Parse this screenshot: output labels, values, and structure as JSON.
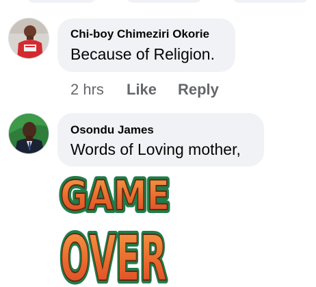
{
  "comments": [
    {
      "author": "Chi-boy Chimeziri Okorie",
      "text": "Because of Religion.",
      "meta": {
        "time": "2 hrs",
        "like": "Like",
        "reply": "Reply"
      }
    },
    {
      "author": "Osondu James",
      "text": "Words of Loving mother,",
      "sticker": {
        "line1": "GAME",
        "line2": "OVER"
      }
    }
  ],
  "colors": {
    "bubble": "#f0f2f5",
    "meta_text": "#65676b",
    "sticker_orange": "#e9692c",
    "sticker_green": "#1f7d4a"
  }
}
